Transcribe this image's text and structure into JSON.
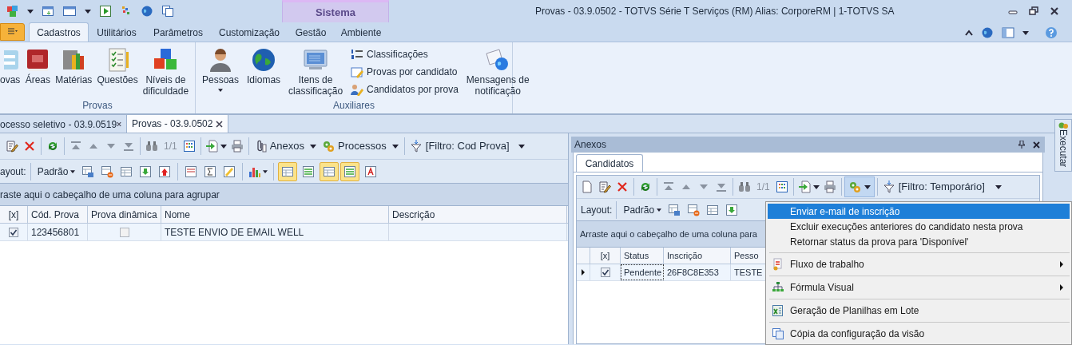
{
  "window": {
    "title": "Provas - 03.9.0502 - TOTVS Série T Serviços (RM) Alias: CorporeRM | 1-TOTVS SA"
  },
  "contextual_group": {
    "label": "Sistema"
  },
  "ribbon_tabs": [
    {
      "label": "Cadastros",
      "selected": true
    },
    {
      "label": "Utilitários",
      "selected": false
    },
    {
      "label": "Parâmetros",
      "selected": false
    },
    {
      "label": "Customização",
      "selected": false
    },
    {
      "label": "Gestão",
      "selected": false
    },
    {
      "label": "Ambiente",
      "selected": false
    }
  ],
  "ribbon_groups": [
    {
      "label": "Provas",
      "items": [
        {
          "kind": "large",
          "lines": [
            "ovas"
          ],
          "dropdown": false
        },
        {
          "kind": "large",
          "lines": [
            "Áreas"
          ],
          "dropdown": false
        },
        {
          "kind": "large",
          "lines": [
            "Matérias"
          ],
          "dropdown": false
        },
        {
          "kind": "large",
          "lines": [
            "Questões"
          ],
          "dropdown": false
        },
        {
          "kind": "large",
          "lines": [
            "Níveis de",
            "dificuldade"
          ],
          "dropdown": false
        }
      ]
    },
    {
      "label": "Auxiliares",
      "items": [
        {
          "kind": "large",
          "lines": [
            "Pessoas"
          ],
          "dropdown": true
        },
        {
          "kind": "large",
          "lines": [
            "Idiomas"
          ],
          "dropdown": false
        },
        {
          "kind": "large",
          "lines": [
            "Itens de",
            "classificação"
          ],
          "dropdown": false
        },
        {
          "kind": "stack",
          "entries": [
            "Classificações",
            "Provas por candidato",
            "Candidatos por prova"
          ]
        },
        {
          "kind": "large",
          "lines": [
            "Mensagens de",
            "notificação"
          ],
          "dropdown": false
        }
      ]
    }
  ],
  "document_tabs": [
    {
      "label": "ocesso seletivo - 03.9.0519",
      "selected": false
    },
    {
      "label": "Provas - 03.9.0502",
      "selected": true
    }
  ],
  "main_grid": {
    "toolbar": {
      "page": "1/1",
      "menus": [
        "Anexos",
        "Processos"
      ],
      "filter": "[Filtro: Cod Prova]"
    },
    "layout_label": "ayout:",
    "layout": "Padrão",
    "view_toggles": [
      {
        "selected": true
      },
      {
        "selected": false
      },
      {
        "selected": true
      },
      {
        "selected": true
      },
      {
        "selected": false
      }
    ],
    "group_hint": "raste aqui o cabeçalho de uma coluna para agrupar",
    "columns": [
      "[x]",
      "Cód. Prova",
      "Prova dinâmica",
      "Nome",
      "Descrição"
    ],
    "rows": [
      {
        "checked": true,
        "code": "123456801",
        "dynamic": false,
        "name": "TESTE ENVIO DE EMAIL WELL"
      }
    ]
  },
  "anexos_panel": {
    "title": "Anexos",
    "tabs": [
      {
        "label": "Candidatos",
        "selected": true
      }
    ],
    "toolbar": {
      "page": "1/1",
      "filter": "[Filtro: Temporário]"
    },
    "layout_label": "Layout:",
    "layout": "Padrão",
    "group_hint": "Arraste aqui o cabeçalho de uma coluna para",
    "columns": [
      "[x]",
      "Status",
      "Inscrição",
      "Pesso"
    ],
    "rows": [
      {
        "selected": true,
        "checked": true,
        "status": "Pendente",
        "inscription": "26F8C8E353",
        "person": "TESTE"
      }
    ]
  },
  "side_tab": {
    "label": "Executar"
  },
  "context_menu": {
    "groups": [
      [
        {
          "label": "Enviar e-mail de inscrição",
          "selected": true,
          "submenu": false
        },
        {
          "label": "Excluir execuções anteriores do candidato nesta prova",
          "selected": false,
          "submenu": false
        },
        {
          "label": "Retornar status da prova para 'Disponível'",
          "selected": false,
          "submenu": false
        }
      ],
      [
        {
          "label": "Fluxo de trabalho",
          "selected": false,
          "submenu": true
        }
      ],
      [
        {
          "label": "Fórmula Visual",
          "selected": false,
          "submenu": true
        }
      ],
      [
        {
          "label": "Geração de Planilhas em Lote",
          "selected": false,
          "submenu": false
        }
      ],
      [
        {
          "label": "Cópia da configuração da visão",
          "selected": false,
          "submenu": false
        }
      ]
    ]
  }
}
